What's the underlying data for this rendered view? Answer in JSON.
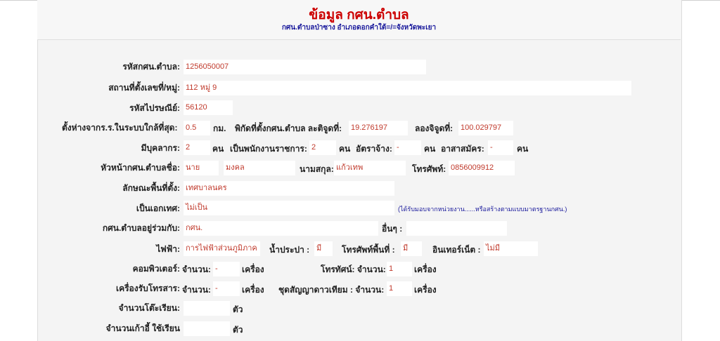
{
  "header": {
    "title": "ข้อมูล กศน.ตำบล",
    "subtitle": "กศน.ตำบลป่าซาง อำเภอดอกคำใต้=/=จังหวัดพะเยา"
  },
  "form": {
    "code": {
      "label": "รหัสกศน.ตำบล:",
      "value": "1256050007"
    },
    "address": {
      "label": "สถานที่ตั้งเลขที่/หมู่:",
      "value": "112 หมู่ 9"
    },
    "postal": {
      "label": "รหัสไปรษณีย์:",
      "value": "56120"
    },
    "distance": {
      "label": "ตั้งห่างจากร.ร.ในระบบใกล้ที่สุด:",
      "value": "0.5",
      "unit": "กม.",
      "lat_label": "พิกัดที่ตั้งกศน.ตำบล ละติจูดที่:",
      "lat_value": "19.276197",
      "lon_label": "ลองจิจูดที่:",
      "lon_value": "100.029797"
    },
    "staff": {
      "label": "มีบุคลากร:",
      "value": "2",
      "unit": "คน",
      "civil_label": "เป็นพนักงานราชการ:",
      "civil_value": "2",
      "civil_unit": "คน",
      "temp_label": "อัตราจ้าง:",
      "temp_value": "-",
      "temp_unit": "คน",
      "volunteer_label": "อาสาสมัคร:",
      "volunteer_value": "-",
      "volunteer_unit": "คน"
    },
    "head": {
      "label": "หัวหน้ากศน.ตำบลชื่อ:",
      "prefix": "นาย",
      "first_name": "มงคล",
      "surname_label": "นามสกุล:",
      "surname": "แก้วเทพ",
      "phone_label": "โทรศัพท์:",
      "phone": "0856009912"
    },
    "area": {
      "label": "ลักษณะพื้นที่ตั้ง:",
      "value": "เทศบาลนคร"
    },
    "unique": {
      "label": "เป็นเอกเทศ:",
      "value": "ไม่เป็น",
      "note": "(ได้รับมอบจากหน่วยงาน......หรือสร้างตามแบบมาตรฐานกศน.)"
    },
    "shared": {
      "label": "กศน.ตำบลอยู่ร่วมกับ:",
      "value": "กศน.",
      "other_label": "อื่นๆ :",
      "other_value": ""
    },
    "electric": {
      "label": "ไฟฟ้า:",
      "value": "การไฟฟ้าส่วนภูมิภาค",
      "water_label": "น้ำประปา :",
      "water_value": "มี",
      "phone_label": "โทรศัพท์พื้นที่ :",
      "phone_value": "มี",
      "internet_label": "อินเทอร์เน็ต :",
      "internet_value": "ไม่มี"
    },
    "computer": {
      "label": "คอมพิวเตอร์:",
      "count_label": "จำนวน:",
      "count_value": "-",
      "unit": "เครื่อง",
      "tv_label": "โทรทัศน์: จำนวน:",
      "tv_value": "1",
      "tv_unit": "เครื่อง"
    },
    "fax": {
      "label": "เครื่องรับโทรสาร:",
      "count_label": "จำนวน:",
      "count_value": "-",
      "unit": "เครื่อง",
      "sat_label": "ชุดสัญญาดาวเทียม : จำนวน:",
      "sat_value": "1",
      "sat_unit": "เครื่อง"
    },
    "desks": {
      "label": "จำนวนโต๊ะเรียน:",
      "value": "",
      "unit": "ตัว"
    },
    "chairs": {
      "label": "จำนวนเก้าอี้ ใช้เรียน",
      "value": "",
      "unit": "ตัว"
    }
  }
}
